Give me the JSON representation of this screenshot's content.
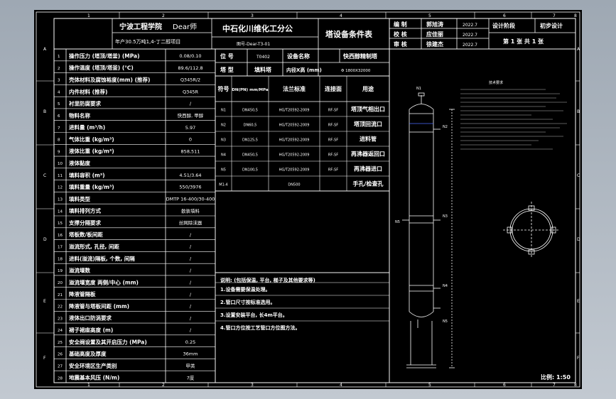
{
  "frame": {
    "col_numbers": [
      "1",
      "2",
      "3",
      "4",
      "5",
      "6",
      "7",
      "8"
    ],
    "row_letters": [
      "A",
      "B",
      "C",
      "D",
      "E",
      "F"
    ]
  },
  "header": {
    "school": "宁波工程学院",
    "school_tag": "Dear师",
    "project": "年产30.5万吨1,4-丁二醇项目",
    "company": "中石化川维化工分公",
    "drawing_no": "图号-Dear-T3-01",
    "title": "塔设备条件表"
  },
  "signatures": {
    "rows": [
      {
        "role": "编  制",
        "name": "郭旭涛",
        "date": "2022.7"
      },
      {
        "role": "校  核",
        "name": "应佳丽",
        "date": "2022.7"
      },
      {
        "role": "审  核",
        "name": "徐建杰",
        "date": "2022.7"
      }
    ],
    "stage_label": "设计阶段",
    "stage_value": "初步设计",
    "sheet_info": "第 1 张  共 1 张"
  },
  "position": {
    "label_pos": "位  号",
    "pos_value": "T0402",
    "label_name": "设备名称",
    "name_value": "快西醇精制塔",
    "label_type": "塔  型",
    "type_value": "填料塔",
    "label_size": "内径X高 (mm)",
    "size_value": "Φ 1800X32000"
  },
  "nozzle_header": [
    "符号",
    "DN(PN) mm/MPa",
    "法兰标准",
    "连接面",
    "用途"
  ],
  "nozzles": [
    {
      "sym": "N1",
      "dn": "DN450,5",
      "std": "HG/T20592-2009",
      "face": "RF-SF",
      "use": "塔顶气相出口"
    },
    {
      "sym": "N2",
      "dn": "DN60,5",
      "std": "HG/T20592-2009",
      "face": "RF-SF",
      "use": "塔顶回流口"
    },
    {
      "sym": "N3",
      "dn": "DN125,5",
      "std": "HG/T20592-2009",
      "face": "RF-SF",
      "use": "进料管"
    },
    {
      "sym": "N4",
      "dn": "DN450,5",
      "std": "HG/T20592-2009",
      "face": "RF-SF",
      "use": "再沸器返回口"
    },
    {
      "sym": "N5",
      "dn": "DN100,5",
      "std": "HG/T20592-2009",
      "face": "RF-SF",
      "use": "再沸器进口"
    },
    {
      "sym": "M1-4",
      "dn": "",
      "std": "DN500",
      "face": "",
      "use": "手孔/检查孔"
    }
  ],
  "params": [
    {
      "no": "1",
      "label": "操作压力 (塔顶/塔釜) (MPa)",
      "value": "0.08/0.10"
    },
    {
      "no": "2",
      "label": "操作温度 (塔顶/塔釜) (℃)",
      "value": "89.6/112.8"
    },
    {
      "no": "3",
      "label": "壳体材料及腐蚀裕度(mm) (推荐)",
      "value": "Q345R/2"
    },
    {
      "no": "4",
      "label": "内件材料 (推荐)",
      "value": "Q345R"
    },
    {
      "no": "5",
      "label": "衬里防腐要求",
      "value": "/"
    },
    {
      "no": "6",
      "label": "物料名称",
      "value": "快西醇, 甲醇"
    },
    {
      "no": "7",
      "label": "进料量 (m³/h)",
      "value": "5.97"
    },
    {
      "no": "8",
      "label": "气体比重 (kg/m³)",
      "value": "0"
    },
    {
      "no": "9",
      "label": "液体比重 (kg/m³)",
      "value": "858,511"
    },
    {
      "no": "10",
      "label": "液体黏度",
      "value": ""
    },
    {
      "no": "11",
      "label": "填料容积 (m³)",
      "value": "4.51/3.64"
    },
    {
      "no": "12",
      "label": "填料重量 (kg/m³)",
      "value": "550/3976"
    },
    {
      "no": "13",
      "label": "填料类型",
      "value": "DMTP 16-400/30-400"
    },
    {
      "no": "14",
      "label": "填料排列方式",
      "value": "散装填料"
    },
    {
      "no": "15",
      "label": "支撑分隔要求",
      "value": "丝网除沫器"
    },
    {
      "no": "16",
      "label": "塔板数/板间距",
      "value": "/"
    },
    {
      "no": "17",
      "label": "溢流形式, 孔径, 间距",
      "value": "/"
    },
    {
      "no": "18",
      "label": "进料(溢流)隔板, 个数, 间隔",
      "value": "/"
    },
    {
      "no": "19",
      "label": "溢流堰数",
      "value": "/"
    },
    {
      "no": "20",
      "label": "溢流堰宽度 两侧/中心 (mm)",
      "value": "/"
    },
    {
      "no": "21",
      "label": "降液管隔板",
      "value": "/"
    },
    {
      "no": "22",
      "label": "降液管与塔板间距 (mm)",
      "value": "/"
    },
    {
      "no": "23",
      "label": "液体出口防涡要求",
      "value": "/"
    },
    {
      "no": "24",
      "label": "裙子裙座高度 (m)",
      "value": "/"
    },
    {
      "no": "25",
      "label": "安全阀设置及其开启压力 (MPa)",
      "value": "0.25"
    },
    {
      "no": "26",
      "label": "基础高度及厚度",
      "value": "36mm"
    },
    {
      "no": "27",
      "label": "安全环境区生产类别",
      "value": "甲类"
    },
    {
      "no": "28",
      "label": "地震基本风压 (N/m)",
      "value": "7度"
    }
  ],
  "notes": {
    "title": "说明: (包括保温, 平台, 梯子及其他要求等)",
    "items": [
      "1.设备需要保温处理。",
      "2.管口尺寸按标准选用。",
      "3.设置安装平台, 长4m平台。",
      "4.管口方位按工艺管口方位图方法。"
    ]
  },
  "tower": {
    "labels_left": [
      "N1",
      "N5"
    ],
    "labels_right": [
      "N2",
      "N3",
      "N4",
      "N5"
    ],
    "scale": "比例: 1:50",
    "tech_title": "技术要求"
  },
  "colors": {
    "line": "#ffffff",
    "text": "#ffffff",
    "bg": "#000000"
  }
}
